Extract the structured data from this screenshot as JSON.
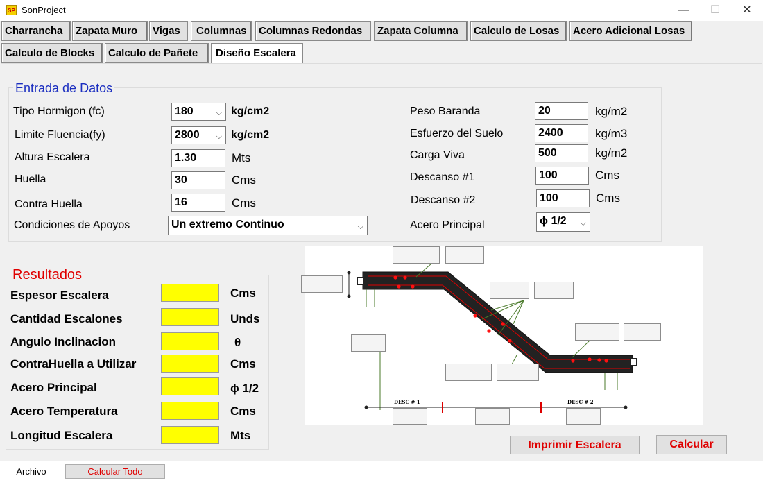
{
  "window": {
    "title": "SonProject",
    "icon_text": "SP",
    "minimize": "—",
    "maximize": "☐",
    "close": "✕"
  },
  "tabs": [
    "Charrancha",
    "Zapata Muro",
    "Vigas",
    "Columnas",
    "Columnas Redondas",
    "Zapata Columna",
    "Calculo de Losas",
    "Acero Adicional Losas",
    "Calculo de Blocks",
    "Calculo de Pañete",
    "Diseño Escalera"
  ],
  "active_tab": "Diseño Escalera",
  "entrada": {
    "legend": "Entrada de Datos",
    "tipo_hormigon": {
      "label": "Tipo Hormigon (fc)",
      "value": "180",
      "unit": "kg/cm2"
    },
    "limite_fluencia": {
      "label": "Limite Fluencia(fy)",
      "value": "2800",
      "unit": "kg/cm2"
    },
    "altura_escalera": {
      "label": "Altura Escalera",
      "value": "1.30",
      "unit": "Mts"
    },
    "huella": {
      "label": "Huella",
      "value": "30",
      "unit": "Cms"
    },
    "contra_huella": {
      "label": "Contra Huella",
      "value": "16",
      "unit": "Cms"
    },
    "condiciones_apoyos": {
      "label": "Condiciones de Apoyos",
      "value": "Un extremo Continuo"
    },
    "peso_baranda": {
      "label": "Peso Baranda",
      "value": "20",
      "unit": "kg/m2"
    },
    "esfuerzo_suelo": {
      "label": "Esfuerzo del Suelo",
      "value": "2400",
      "unit": "kg/m3"
    },
    "carga_viva": {
      "label": "Carga Viva",
      "value": "500",
      "unit": "kg/m2"
    },
    "descanso1": {
      "label": "Descanso #1",
      "value": "100",
      "unit": "Cms"
    },
    "descanso2": {
      "label": "Descanso #2",
      "value": "100",
      "unit": "Cms"
    },
    "acero_principal": {
      "label": "Acero Principal",
      "value": "ϕ 1/2"
    }
  },
  "resultados": {
    "legend": "Resultados",
    "rows": [
      {
        "label": "Espesor Escalera",
        "unit": "Cms"
      },
      {
        "label": "Cantidad Escalones",
        "unit": "Unds"
      },
      {
        "label": "Angulo Inclinacion",
        "unit": "θ"
      },
      {
        "label": "ContraHuella a Utilizar",
        "unit": "Cms"
      },
      {
        "label": "Acero Principal",
        "unit": "ϕ 1/2"
      },
      {
        "label": "Acero Temperatura",
        "unit": "Cms"
      },
      {
        "label": "Longitud Escalera",
        "unit": "Mts"
      }
    ]
  },
  "diagram": {
    "desc1": "DESC # 1",
    "desc2": "DESC # 2"
  },
  "buttons": {
    "imprimir": "Imprimir Escalera",
    "calcular": "Calcular"
  },
  "statusbar": {
    "archivo": "Archivo",
    "calcular_todo": "Calcular Todo"
  },
  "colors": {
    "result_fill": "#ffff00",
    "button_text": "#e00000",
    "legend_entrada": "#1c2fc0",
    "legend_resultados": "#e00000"
  }
}
